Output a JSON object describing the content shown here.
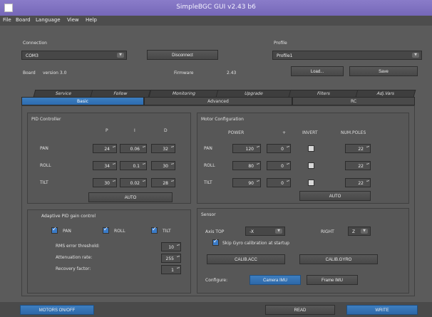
{
  "window": {
    "title": "SimpleBGC GUI v2.43 b6"
  },
  "menu": [
    "File",
    "Board",
    "Language",
    "View",
    "Help"
  ],
  "connection": {
    "label": "Connection",
    "port": "COM3",
    "disconnect_label": "Disconnect",
    "board_label": "Board",
    "board_version": "version 3.0",
    "firmware_label": "Firmware",
    "firmware_value": "2.43"
  },
  "profile": {
    "label": "Profile",
    "value": "Profile1",
    "load_label": "Load...",
    "save_label": "Save"
  },
  "tabs_row1": [
    "Service",
    "Follow",
    "Monitoring",
    "Upgrade",
    "Filters",
    "Adj.Vars"
  ],
  "tabs_row2": [
    "Basic",
    "Advanced",
    "RC"
  ],
  "pid": {
    "title": "PID Controller",
    "headers": [
      "P",
      "I",
      "D"
    ],
    "rows": [
      {
        "axis": "PAN",
        "p": "24",
        "i": "0.06",
        "d": "32"
      },
      {
        "axis": "ROLL",
        "p": "34",
        "i": "0.1",
        "d": "30"
      },
      {
        "axis": "TILT",
        "p": "30",
        "i": "0.02",
        "d": "28"
      }
    ],
    "auto_label": "AUTO"
  },
  "motor": {
    "title": "Motor Configuration",
    "headers": [
      "POWER",
      "+",
      "INVERT",
      "NUM.POLES"
    ],
    "rows": [
      {
        "axis": "PAN",
        "power": "120",
        "plus": "0",
        "invert": false,
        "poles": "22"
      },
      {
        "axis": "ROLL",
        "power": "80",
        "plus": "0",
        "invert": false,
        "poles": "22"
      },
      {
        "axis": "TILT",
        "power": "90",
        "plus": "0",
        "invert": false,
        "poles": "22"
      }
    ],
    "auto_label": "AUTO"
  },
  "adaptive": {
    "title": "Adaptive PID gain control",
    "checks": [
      {
        "label": "PAN",
        "on": true
      },
      {
        "label": "ROLL",
        "on": true
      },
      {
        "label": "TILT",
        "on": true
      }
    ],
    "params": [
      {
        "label": "RMS error threshold:",
        "value": "10"
      },
      {
        "label": "Attenuation rate:",
        "value": "255"
      },
      {
        "label": "Recovery factor:",
        "value": "1"
      }
    ]
  },
  "sensor": {
    "title": "Sensor",
    "axis_top_label": "Axis TOP",
    "axis_top_value": "-X",
    "right_label": "RIGHT",
    "right_value": "Z",
    "skip_gyro_label": "Skip Gyro calibration at startup",
    "skip_gyro": true,
    "calib_acc_label": "CALIB.ACC",
    "calib_gyro_label": "CALIB.GYRO",
    "configure_label": "Configure:",
    "camera_imu_label": "Camera IMU",
    "frame_imu_label": "Frame IMU"
  },
  "bottom": {
    "motors_label": "MOTORS ON/OFF",
    "read_label": "READ",
    "write_label": "WRITE"
  }
}
